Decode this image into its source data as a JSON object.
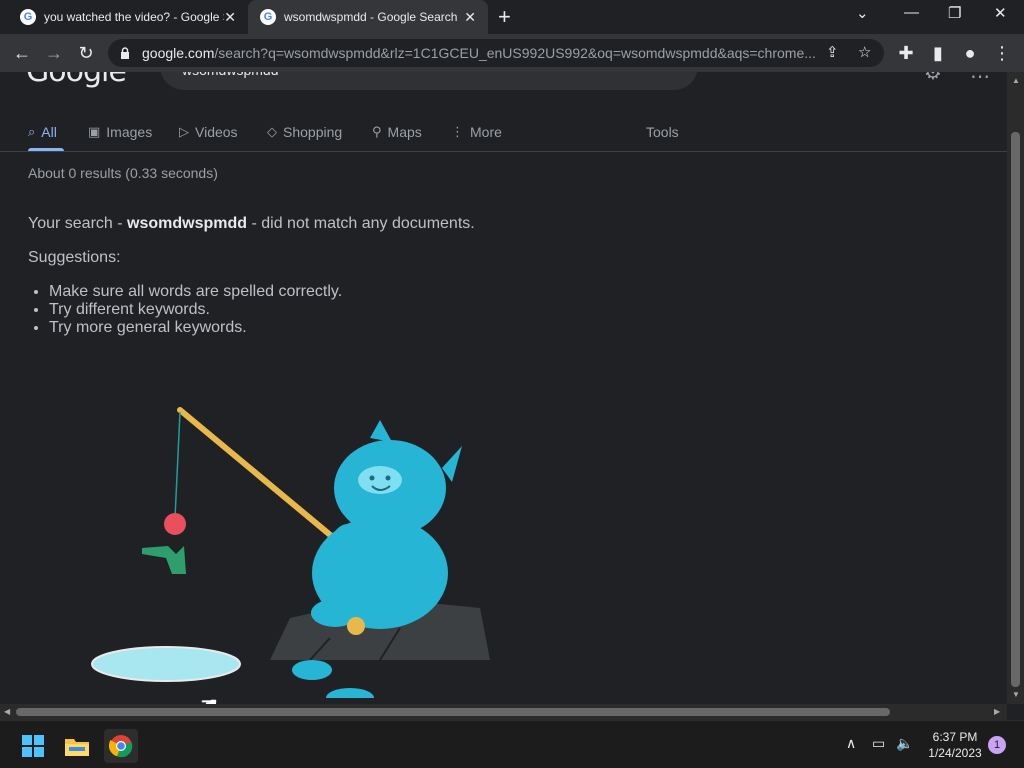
{
  "tabs": [
    {
      "title": "you watched the video? - Google Search",
      "favicon": "G"
    },
    {
      "title": "wsomdwspmdd - Google Search",
      "favicon": "G"
    }
  ],
  "toolbar": {
    "url_domain": "google.com",
    "url_rest": "/search?q=wsomdwspmdd&rlz=1C1GCEU_enUS992US992&oq=wsomdwspmdd&aqs=chrome..."
  },
  "page": {
    "logo": "Google",
    "query": "wsomdwspmdd",
    "nav": [
      {
        "label": "All",
        "icon": "search-icon"
      },
      {
        "label": "Images",
        "icon": "image-icon"
      },
      {
        "label": "Videos",
        "icon": "video-icon"
      },
      {
        "label": "Shopping",
        "icon": "tag-icon"
      },
      {
        "label": "Maps",
        "icon": "map-pin-icon"
      },
      {
        "label": "More",
        "icon": "more-vert-icon"
      }
    ],
    "tools": "Tools",
    "stats": "About 0 results (0.33 seconds)",
    "nomatch_prefix": "Your search - ",
    "nomatch_term": "wsomdwspmdd",
    "nomatch_suffix": " - did not match any documents.",
    "suggestions_label": "Suggestions:",
    "suggestions": [
      "Make sure all words are spelled correctly.",
      "Try different keywords.",
      "Try more general keywords."
    ]
  },
  "taskbar": {
    "time": "6:37 PM",
    "date": "1/24/2023",
    "notifications": "1"
  },
  "colors": {
    "accent": "#8ab4f8",
    "background": "#202124"
  }
}
